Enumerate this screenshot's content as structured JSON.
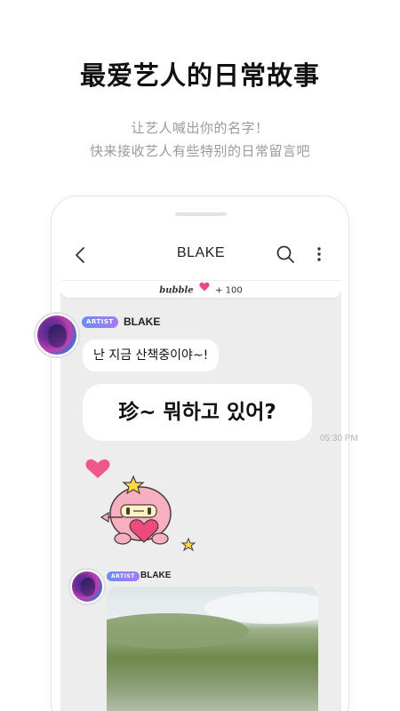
{
  "promo": {
    "title": "最爱艺人的日常故事",
    "subtitle_line1": "让艺人喊出你的名字！",
    "subtitle_line2": "快来接收艺人有些特别的日常留言吧"
  },
  "appbar": {
    "back_icon": "chevron-left-icon",
    "title": "BLAKE",
    "search_icon": "search-icon",
    "more_icon": "more-vertical-icon"
  },
  "bubble_bar": {
    "brand": "bubble",
    "heart_icon": "heart-icon",
    "count": "+ 100"
  },
  "messages": [
    {
      "badge": "ARTIST",
      "sender": "BLAKE",
      "texts": [
        "난 지금 산책중이야~!",
        "珍~ 뭐하고 있어?"
      ],
      "time": "05:30 PM"
    },
    {
      "badge": "ARTIST",
      "sender": "BLAKE"
    }
  ],
  "colors": {
    "highlight": "#fde96b",
    "screen_bg": "#ededed",
    "badge_gradient_start": "#6b8cf5",
    "badge_gradient_end": "#a67cf2",
    "heart": "#e8488a"
  }
}
